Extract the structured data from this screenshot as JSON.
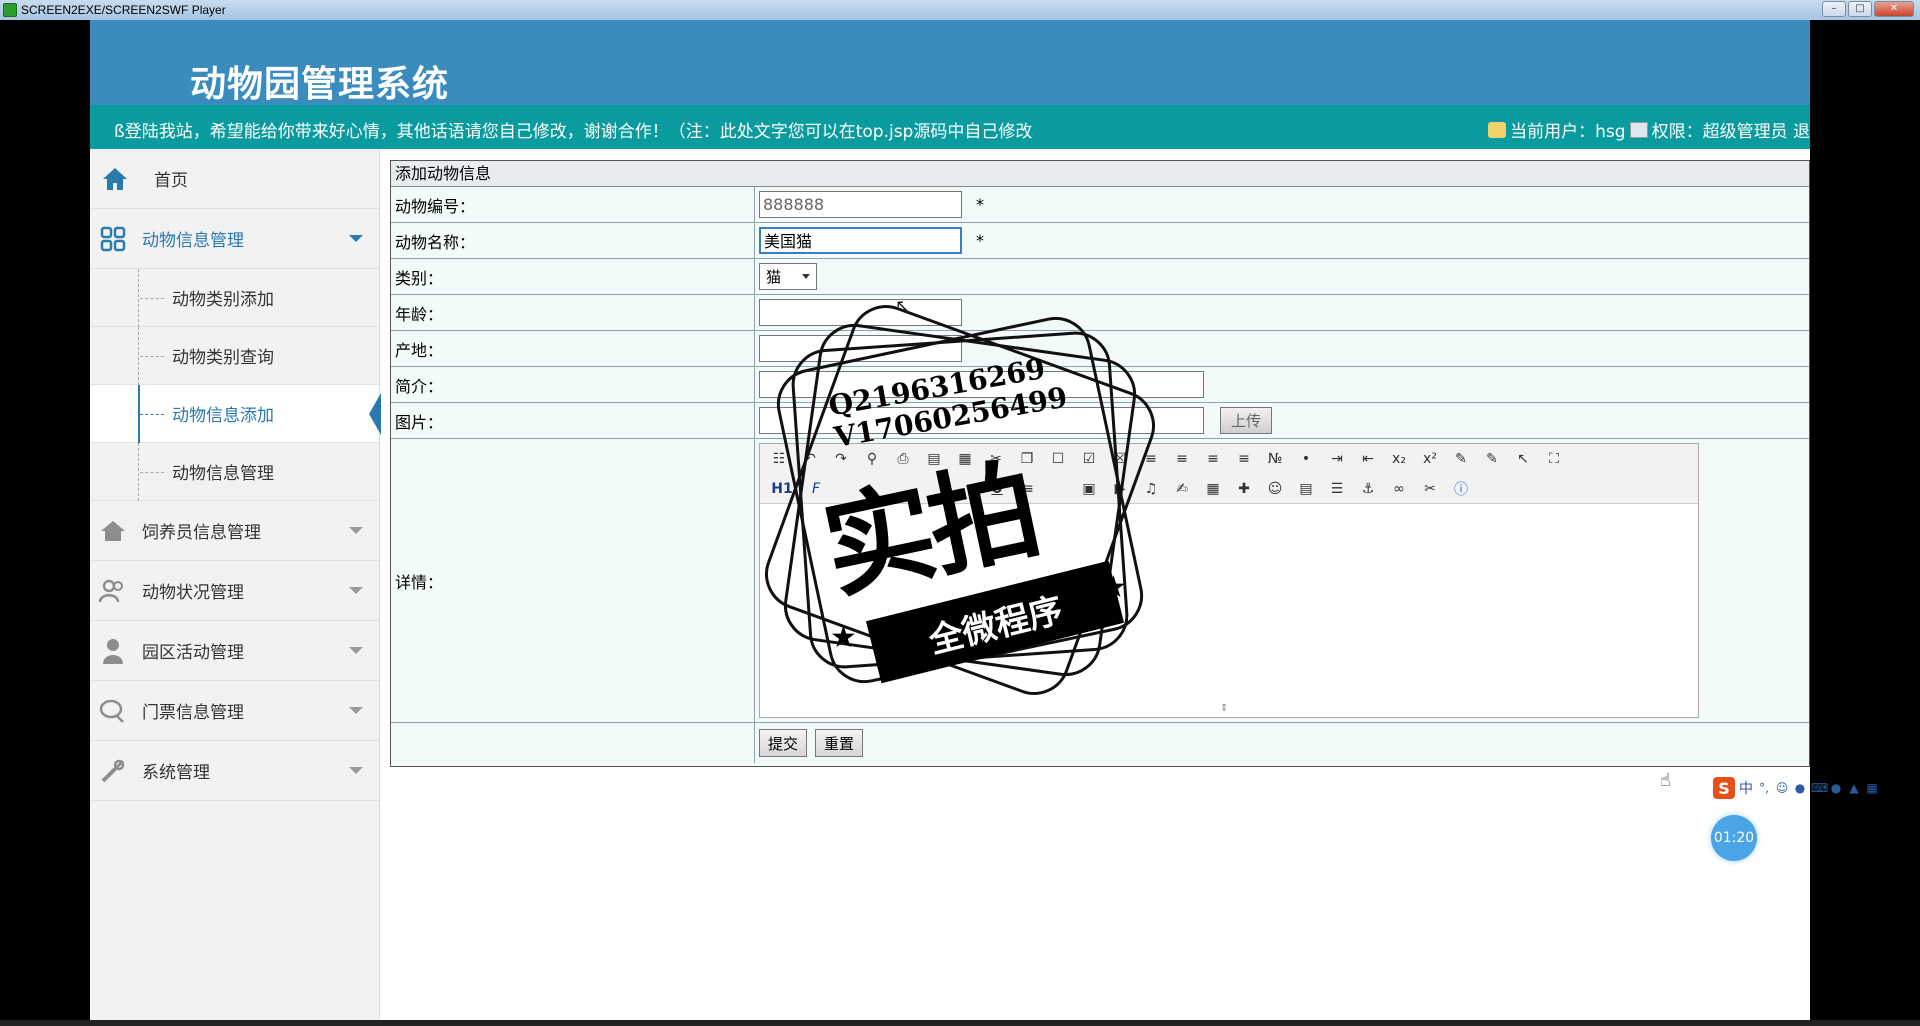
{
  "window": {
    "title": "SCREEN2EXE/SCREEN2SWF Player",
    "controls": [
      "minimize",
      "restore",
      "close"
    ]
  },
  "header": {
    "system_title": "动物园管理系统",
    "notice": "ß登陆我站，希望能给你带来好心情，其他话语请您自己修改，谢谢合作！（注：此处文字您可以在top.jsp源码中自己修改",
    "current_user_label": "当前用户：hsg",
    "permission_label": "权限：超级管理员 退"
  },
  "sidebar": {
    "home": "首页",
    "groups": [
      {
        "label": "动物信息管理",
        "icon": "grid-icon",
        "expanded": true,
        "items": [
          "动物类别添加",
          "动物类别查询",
          "动物信息添加",
          "动物信息管理"
        ],
        "active_index": 2
      },
      {
        "label": "饲养员信息管理",
        "icon": "home-icon"
      },
      {
        "label": "动物状况管理",
        "icon": "users-icon"
      },
      {
        "label": "园区活动管理",
        "icon": "person-icon"
      },
      {
        "label": "门票信息管理",
        "icon": "chat-icon"
      },
      {
        "label": "系统管理",
        "icon": "tools-icon"
      }
    ]
  },
  "form": {
    "heading": "添加动物信息",
    "fields": {
      "animal_id": {
        "label": "动物编号：",
        "value": "888888",
        "required_mark": "*"
      },
      "animal_name": {
        "label": "动物名称：",
        "value": "美国猫",
        "required_mark": "*"
      },
      "category": {
        "label": "类别：",
        "selected": "猫"
      },
      "age": {
        "label": "年龄：",
        "value": ""
      },
      "origin": {
        "label": "产地：",
        "value": ""
      },
      "intro": {
        "label": "简介：",
        "value": ""
      },
      "picture": {
        "label": "图片：",
        "value": "",
        "upload_label": "上传"
      },
      "detail": {
        "label": "详情："
      }
    },
    "submit_label": "提交",
    "reset_label": "重置"
  },
  "editor_toolbar": {
    "row1": [
      "source-icon",
      "undo-icon",
      "redo-icon",
      "preview-icon",
      "print-icon",
      "template-icon",
      "code-icon",
      "cut-icon",
      "copy-icon",
      "paste-icon",
      "paste-text-icon",
      "paste-word-icon",
      "align-left-icon",
      "align-center-icon",
      "align-right-icon",
      "justify-icon",
      "ordered-list-icon",
      "unordered-list-icon",
      "indent-icon",
      "outdent-icon",
      "subscript-icon",
      "superscript-icon",
      "clear-format-icon",
      "select-all-icon",
      "cursor-icon",
      "fullscreen-icon"
    ],
    "row2_labels": {
      "heading": "H1",
      "font": "F",
      "underline": "U"
    }
  },
  "watermark": {
    "contact_q": "Q2196316269",
    "contact_v": "V17060256499",
    "big_text": "实拍",
    "ribbon": "全微程序"
  },
  "widgets": {
    "ime_logo": "S",
    "ime_mode": "中",
    "timer": "01:20"
  },
  "colors": {
    "banner": "#3a8cbf",
    "notice_bar": "#0a9b9e",
    "accent": "#2a7aad"
  }
}
